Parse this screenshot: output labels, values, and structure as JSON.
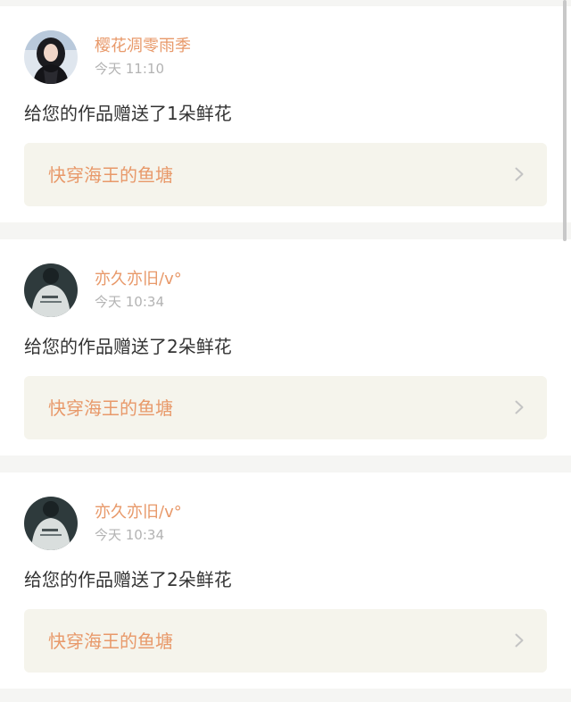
{
  "colors": {
    "accent": "#e8996a",
    "page_bg": "#f5f5f3",
    "card_bg": "#ffffff",
    "link_bg": "#f5f4ec",
    "time_text": "#b3b3b3",
    "body_text": "#333333"
  },
  "notifications": [
    {
      "username": "樱花凋零雨季",
      "time": "今天 11:10",
      "message": "给您的作品赠送了1朵鲜花",
      "work_title": "快穿海王的鱼塘",
      "avatar_icon": "girl-photo-avatar",
      "chevron_icon": "chevron-right-icon"
    },
    {
      "username": "亦久亦旧/v°",
      "time": "今天 10:34",
      "message": "给您的作品赠送了2朵鲜花",
      "work_title": "快穿海王的鱼塘",
      "avatar_icon": "person-back-avatar",
      "chevron_icon": "chevron-right-icon"
    },
    {
      "username": "亦久亦旧/v°",
      "time": "今天 10:34",
      "message": "给您的作品赠送了2朵鲜花",
      "work_title": "快穿海王的鱼塘",
      "avatar_icon": "person-back-avatar",
      "chevron_icon": "chevron-right-icon"
    }
  ]
}
